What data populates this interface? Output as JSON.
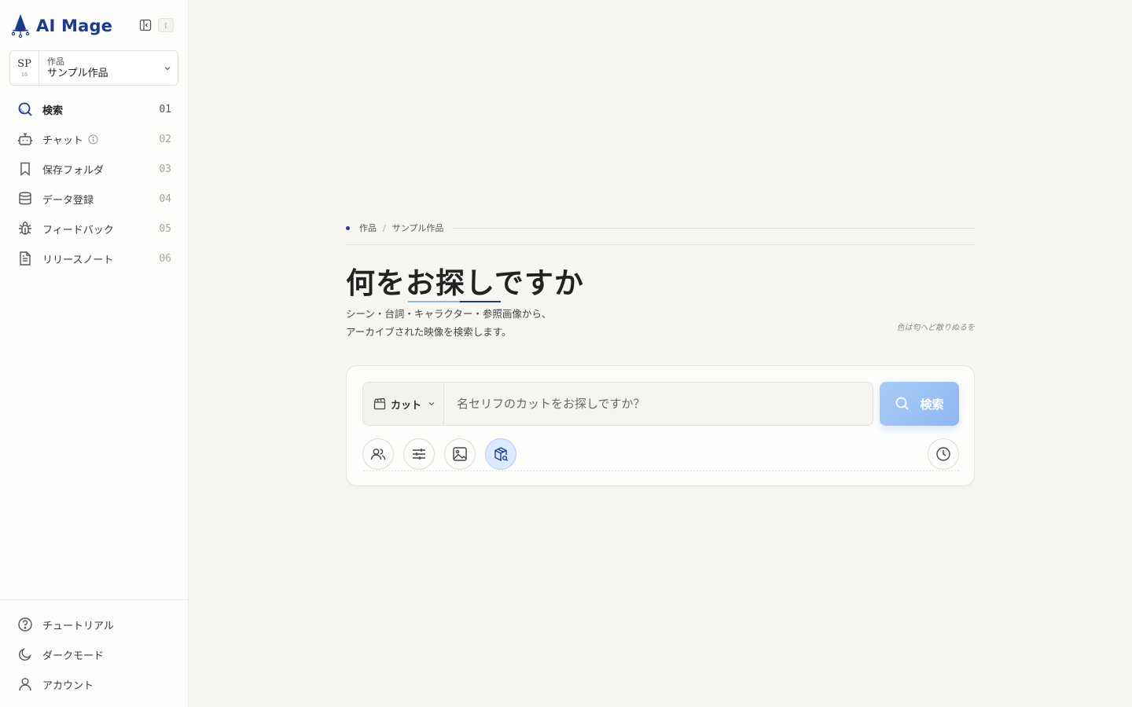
{
  "app": {
    "name": "AI Mage",
    "shortcut_hint": "["
  },
  "project": {
    "code": "SP",
    "number": "16",
    "label": "作品",
    "name": "サンプル作品"
  },
  "nav": {
    "items": [
      {
        "label": "検索",
        "index": "01",
        "icon": "search-icon",
        "active": true
      },
      {
        "label": "チャット",
        "index": "02",
        "icon": "bot-icon",
        "info": true
      },
      {
        "label": "保存フォルダ",
        "index": "03",
        "icon": "bookmark-icon"
      },
      {
        "label": "データ登録",
        "index": "04",
        "icon": "database-icon"
      },
      {
        "label": "フィードバック",
        "index": "05",
        "icon": "bug-icon"
      },
      {
        "label": "リリースノート",
        "index": "06",
        "icon": "file-text-icon"
      }
    ],
    "bottom": [
      {
        "label": "チュートリアル",
        "icon": "help-circle-icon"
      },
      {
        "label": "ダークモード",
        "icon": "moon-icon"
      },
      {
        "label": "アカウント",
        "icon": "user-icon"
      }
    ]
  },
  "breadcrumb": {
    "root": "作品",
    "separator": "/",
    "current": "サンプル作品"
  },
  "hero": {
    "title": "何をお探しですか",
    "subtitle": "シーン・台詞・キャラクター・参照画像から、アーカイブされた映像を検索します。",
    "poem": "色は匂へど散りぬるを"
  },
  "search": {
    "type_label": "カット",
    "placeholder": "名セリフのカットをお探しですか？",
    "value": "",
    "button_label": "検索"
  },
  "tools": [
    {
      "icon": "users-icon",
      "active": false
    },
    {
      "icon": "sliders-icon",
      "active": false
    },
    {
      "icon": "image-icon",
      "active": false
    },
    {
      "icon": "package-search-icon",
      "active": true
    }
  ],
  "colors": {
    "brand": "#1e3a8a",
    "accent_light": "#93b4f0",
    "search_button": "#a9cdf7",
    "background": "#f7f6f3"
  }
}
